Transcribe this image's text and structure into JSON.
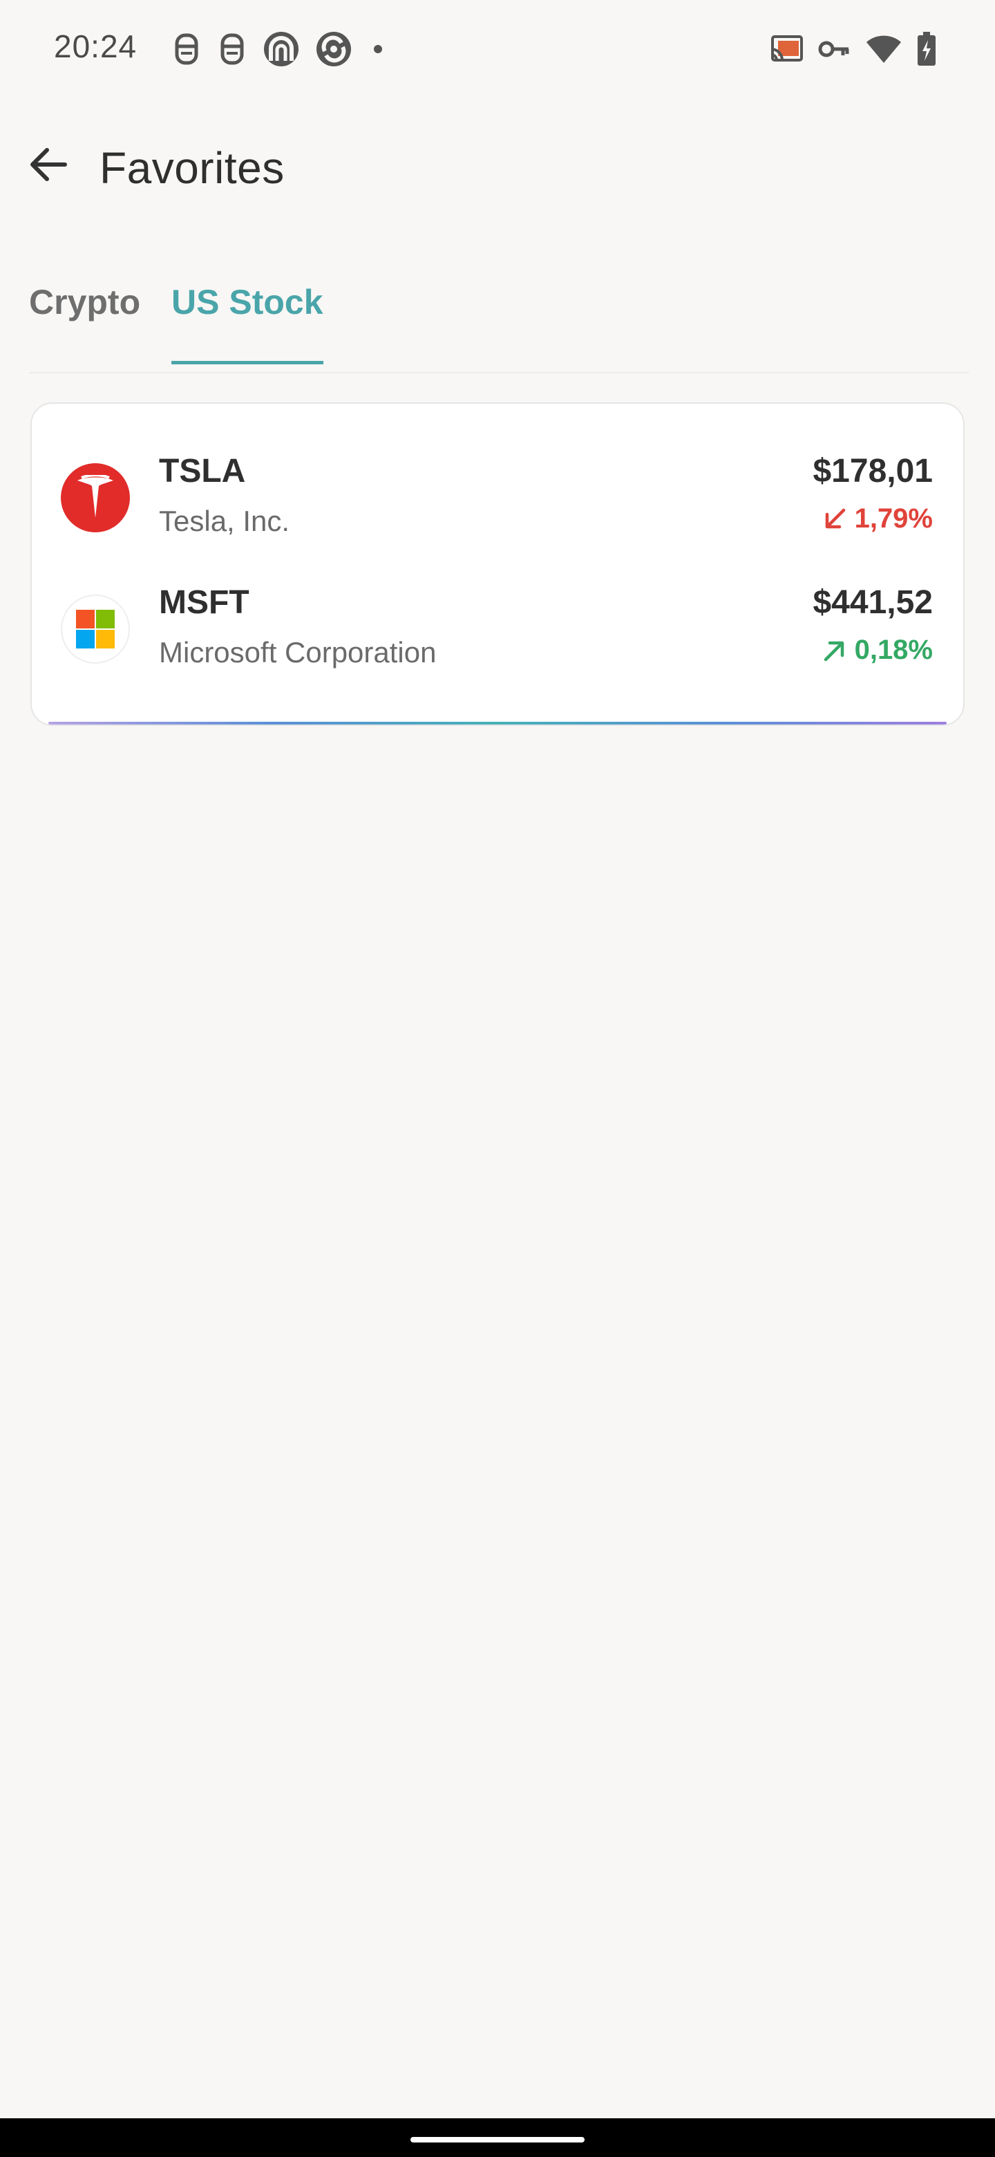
{
  "status_bar": {
    "time": "20:24",
    "left_icons": [
      "notification-app-icon",
      "notification-app-icon",
      "arc-app-icon",
      "sync-app-icon",
      "more-dot-icon"
    ],
    "right_icons": [
      "cast-icon",
      "vpn-key-icon",
      "wifi-icon",
      "battery-charging-icon"
    ]
  },
  "header": {
    "back_icon": "arrow-left-icon",
    "title": "Favorites"
  },
  "tabs": [
    {
      "label": "Crypto",
      "active": false
    },
    {
      "label": "US Stock",
      "active": true
    }
  ],
  "stocks": [
    {
      "symbol": "TSLA",
      "company": "Tesla, Inc.",
      "price": "$178,01",
      "change": "1,79%",
      "direction": "down",
      "logo": "tesla-logo-icon",
      "color": "#e0433a"
    },
    {
      "symbol": "MSFT",
      "company": "Microsoft Corporation",
      "price": "$441,52",
      "change": "0,18%",
      "direction": "up",
      "logo": "microsoft-logo-icon",
      "color": "#34a864"
    }
  ],
  "colors": {
    "accent": "#4aa5aa",
    "background": "#f8f7f5",
    "down": "#e0433a",
    "up": "#34a864"
  }
}
